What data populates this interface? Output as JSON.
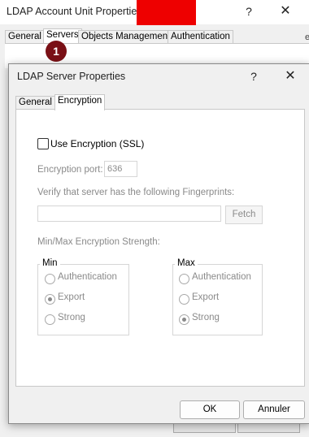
{
  "background_window": {
    "title": "LDAP Account Unit Properties",
    "help_glyph": "?",
    "close_glyph": "✕",
    "tabs": [
      {
        "label": "General"
      },
      {
        "label": "Servers"
      },
      {
        "label": "Objects Management"
      },
      {
        "label": "Authentication"
      }
    ],
    "edge_fragment": "es",
    "step_badge": "1",
    "redaction_color": "#ee0000"
  },
  "dialog": {
    "title": "LDAP Server Properties",
    "help_glyph": "?",
    "close_glyph": "✕",
    "tabs": [
      {
        "label": "General"
      },
      {
        "label": "Encryption"
      }
    ],
    "active_tab": "Encryption",
    "use_encryption_label": "Use Encryption (SSL)",
    "use_encryption_checked": false,
    "port_label": "Encryption port:",
    "port_value": "636",
    "fingerprints_label": "Verify that server has the following Fingerprints:",
    "fingerprint_value": "",
    "fetch_label": "Fetch",
    "strength_label": "Min/Max Encryption Strength:",
    "min_group": {
      "title": "Min",
      "options": [
        "Authentication",
        "Export",
        "Strong"
      ],
      "selected": "Export"
    },
    "max_group": {
      "title": "Max",
      "options": [
        "Authentication",
        "Export",
        "Strong"
      ],
      "selected": "Strong"
    },
    "ok_label": "OK",
    "cancel_label": "Annuler"
  }
}
